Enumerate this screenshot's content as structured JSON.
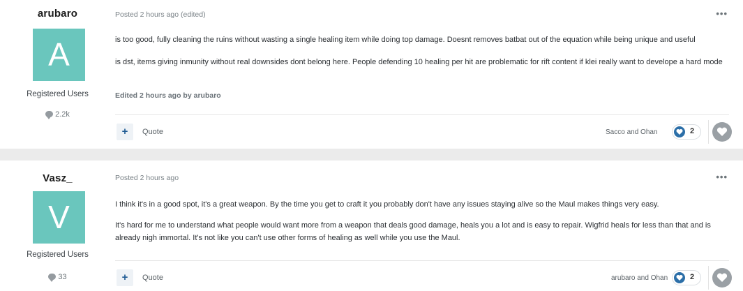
{
  "posts": [
    {
      "author": "arubaro",
      "avatar_letter": "A",
      "group": "Registered Users",
      "count": "2.2k",
      "meta": "Posted 2 hours ago (edited)",
      "menu": "•••",
      "paragraphs": [
        "is too good, fully cleaning the ruins without wasting a single healing item while doing top damage. Doesnt removes batbat out of the equation while being unique and useful",
        "is dst, items giving inmunity without real downsides dont belong here. People defending 10 healing per hit are problematic for rift content if klei really want to develope a hard mode"
      ],
      "edited_note": "Edited 2 hours ago by arubaro",
      "plus": "+",
      "quote": "Quote",
      "reacted_by": "Sacco and Ohan",
      "reaction_count": "2"
    },
    {
      "author": "Vasz_",
      "avatar_letter": "V",
      "group": "Registered Users",
      "count": "33",
      "meta": "Posted 2 hours ago",
      "menu": "•••",
      "paragraphs": [
        "I think it's in a good spot, it's a great weapon. By the time you get to craft it you probably don't have any issues staying alive so the Maul makes things very easy.",
        "It's hard for me to understand what people would want more from a weapon that deals good damage, heals you a lot and is easy to repair. Wigfrid heals for less than that and is already nigh immortal. It's not like you can't use other forms of healing as well while you use the Maul."
      ],
      "plus": "+",
      "quote": "Quote",
      "reacted_by": "arubaro and Ohan",
      "reaction_count": "2"
    }
  ],
  "icons": {
    "comment": "comment-bubble-icon",
    "heart": "heart-icon",
    "menu": "ellipsis-icon"
  },
  "colors": {
    "avatar": "#6ac6bd",
    "heart_active": "#2c6fa8",
    "heart_inactive": "#9aa0a5"
  }
}
